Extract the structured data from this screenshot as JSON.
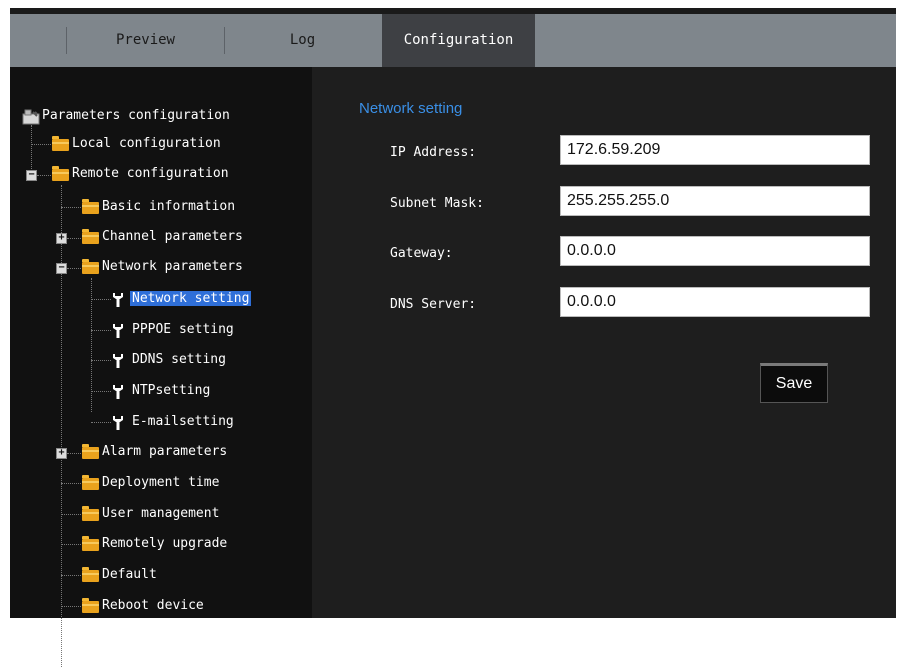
{
  "tabs": [
    {
      "label": "Preview"
    },
    {
      "label": "Log"
    },
    {
      "label": "Configuration"
    }
  ],
  "tree": {
    "root": "Parameters configuration",
    "local": "Local configuration",
    "remote": "Remote configuration",
    "basic": "Basic information",
    "channel": "Channel parameters",
    "network": "Network parameters",
    "network_setting": "Network setting",
    "pppoe": "PPPOE setting",
    "ddns": "DDNS setting",
    "ntp": "NTPsetting",
    "email": "E-mailsetting",
    "alarm": "Alarm parameters",
    "deployment": "Deployment time",
    "user": "User management",
    "upgrade": "Remotely upgrade",
    "default": "Default",
    "reboot": "Reboot device"
  },
  "form": {
    "title": "Network setting",
    "ip_label": "IP Address:",
    "ip_value": "172.6.59.209",
    "mask_label": "Subnet Mask:",
    "mask_value": "255.255.255.0",
    "gateway_label": "Gateway:",
    "gateway_value": "0.0.0.0",
    "dns_label": "DNS Server:",
    "dns_value": "0.0.0.0",
    "save_label": "Save"
  },
  "colors": {
    "accent": "#3a8fe6",
    "selection": "#2f6fd8",
    "folder": "#e9a21d",
    "tabbar": "#7f868c",
    "active_tab": "#3e4044"
  }
}
